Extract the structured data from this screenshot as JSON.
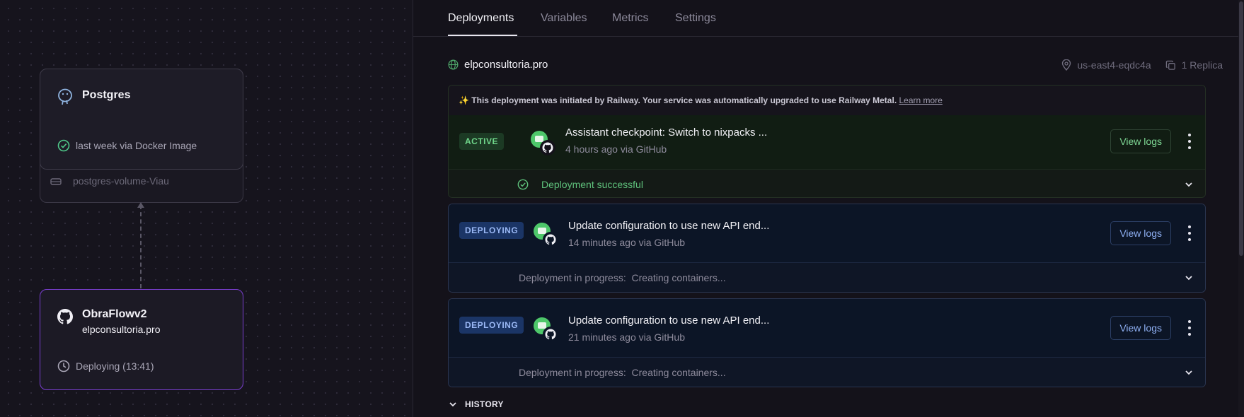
{
  "canvas": {
    "postgres": {
      "title": "Postgres",
      "status": "last week via Docker Image",
      "volume": "postgres-volume-Viau"
    },
    "obraflow": {
      "title": "ObraFlowv2",
      "domain": "elpconsultoria.pro",
      "status": "Deploying (13:41)"
    }
  },
  "panel": {
    "tabs": [
      "Deployments",
      "Variables",
      "Metrics",
      "Settings"
    ],
    "active_tab": "Deployments",
    "domain": "elpconsultoria.pro",
    "region": "us-east4-eqdc4a",
    "replicas": "1 Replica",
    "notice": {
      "emoji": "✨",
      "text": "This deployment was initiated by Railway. Your service was automatically upgraded to use Railway Metal.",
      "link": "Learn more"
    },
    "deployments": [
      {
        "status": "ACTIVE",
        "commit": "Assistant checkpoint: Switch to nixpacks ...",
        "meta": "4 hours ago via GitHub",
        "action": "View logs",
        "footer": "Deployment successful"
      },
      {
        "status": "DEPLOYING",
        "commit": "Update configuration to use new API end...",
        "meta": "14 minutes ago via GitHub",
        "action": "View logs",
        "footer": "Deployment in progress:  Creating containers..."
      },
      {
        "status": "DEPLOYING",
        "commit": "Update configuration to use new API end...",
        "meta": "21 minutes ago via GitHub",
        "action": "View logs",
        "footer": "Deployment in progress:  Creating containers..."
      }
    ],
    "history_label": "HISTORY"
  },
  "colors": {
    "active_green": "#6fd68a",
    "deploying_blue": "#9ab8f5",
    "accent_purple": "#7b3fd1"
  }
}
